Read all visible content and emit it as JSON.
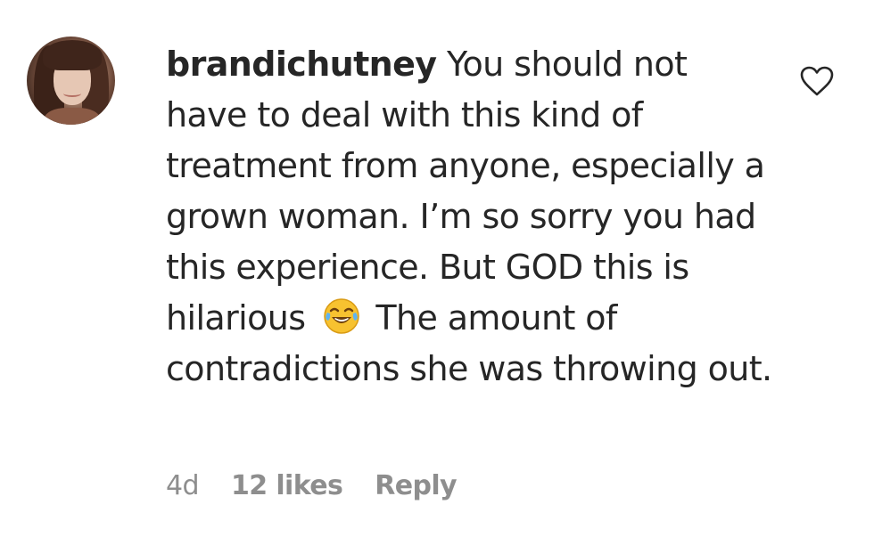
{
  "comment": {
    "username": "brandichutney",
    "text_before_emoji": "You should not have to deal with this kind of treatment from anyone, especially a grown woman. I’m so sorry you had this experience. But GOD this is hilarious",
    "emoji_icon": "face-with-tears-of-joy-icon",
    "text_after_emoji": "The amount of contradictions she was throwing out.",
    "time": "4d",
    "likes": "12 likes",
    "reply_label": "Reply",
    "heart_icon": "heart-outline-icon"
  },
  "colors": {
    "text": "#262626",
    "meta": "#8e8e8e",
    "background": "#ffffff"
  }
}
